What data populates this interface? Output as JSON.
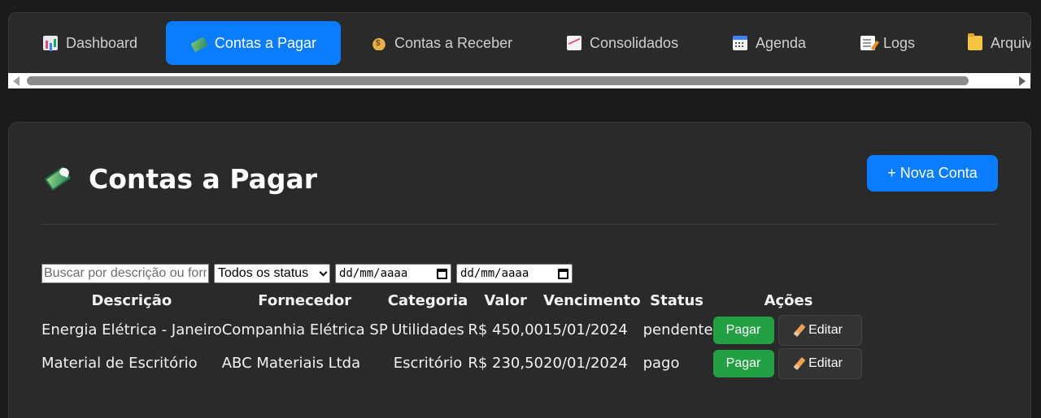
{
  "nav": {
    "tabs": [
      {
        "label": "Dashboard",
        "icon": "bar-chart-icon",
        "active": false
      },
      {
        "label": "Contas a Pagar",
        "icon": "money-wings-icon",
        "active": true
      },
      {
        "label": "Contas a Receber",
        "icon": "money-bag-icon",
        "active": false
      },
      {
        "label": "Consolidados",
        "icon": "trending-chart-icon",
        "active": false
      },
      {
        "label": "Agenda",
        "icon": "calendar-icon",
        "active": false
      },
      {
        "label": "Logs",
        "icon": "memo-icon",
        "active": false
      },
      {
        "label": "Arquivos",
        "icon": "folder-icon",
        "active": false
      }
    ]
  },
  "page": {
    "title": "Contas a Pagar",
    "new_button": "+ Nova Conta"
  },
  "filters": {
    "search_placeholder": "Buscar por descrição ou fornecedor",
    "status_selected": "Todos os status",
    "date_from": "dd/mm/aaaa",
    "date_to": "dd/mm/aaaa"
  },
  "table": {
    "headers": [
      "Descrição",
      "Fornecedor",
      "Categoria",
      "Valor",
      "Vencimento",
      "Status",
      "Ações"
    ],
    "rows": [
      {
        "descricao": "Energia Elétrica - Janeiro",
        "fornecedor": "Companhia Elétrica SP",
        "categoria": "Utilidades",
        "valor": "R$ 450,00",
        "vencimento": "15/01/2024",
        "status": "pendente"
      },
      {
        "descricao": "Material de Escritório",
        "fornecedor": "ABC Materiais Ltda",
        "categoria": "Escritório",
        "valor": "R$ 230,50",
        "vencimento": "20/01/2024",
        "status": "pago"
      }
    ],
    "pay_label": "Pagar",
    "edit_label": "Editar"
  },
  "colors": {
    "accent": "#0a7cff",
    "pay": "#22a043",
    "background": "#1b1b1b",
    "card": "#2a2a2a"
  }
}
